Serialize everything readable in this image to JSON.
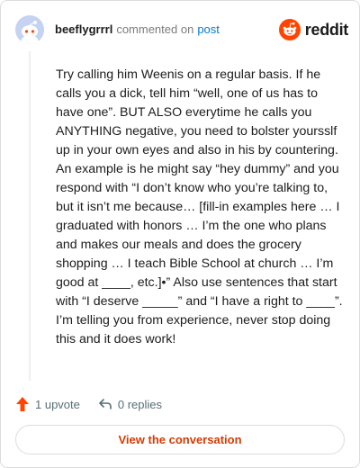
{
  "header": {
    "username": "beeflygrrrl",
    "action": "commented on",
    "post_link": "post",
    "brand": "reddit"
  },
  "comment": {
    "body": "Try calling him Weenis on a regular basis. If he calls you a dick, tell him “well, one of us has to have one”. BUT ALSO everytime he calls you ANYTHING negative, you need to bolster yoursslf up in your own eyes and also in his by countering. An example is he might say “hey dummy” and you respond with “I don’t know who you’re talking to, but it isn’t me because… [fill-in examples here … I graduated with honors … I’m the one who plans and makes our meals and does the grocery shopping … I teach Bible School at church … I’m good at ____, etc.]•” Also use sentences that start with “I deserve _____” and “I have a right to ____”. I’m telling you from experience, never stop doing this and it does work!"
  },
  "actions": {
    "upvote_label": "1 upvote",
    "upvote_icon": "upvote-arrow-icon",
    "replies_label": "0 replies",
    "replies_icon": "reply-arrow-icon"
  },
  "footer": {
    "view_conversation_label": "View the conversation"
  },
  "colors": {
    "brand_orange": "#ff4500",
    "link_blue": "#0079d3",
    "button_text": "#d93a00",
    "muted": "#7c7c7c",
    "avatar_bg": "#c6d2f2"
  }
}
